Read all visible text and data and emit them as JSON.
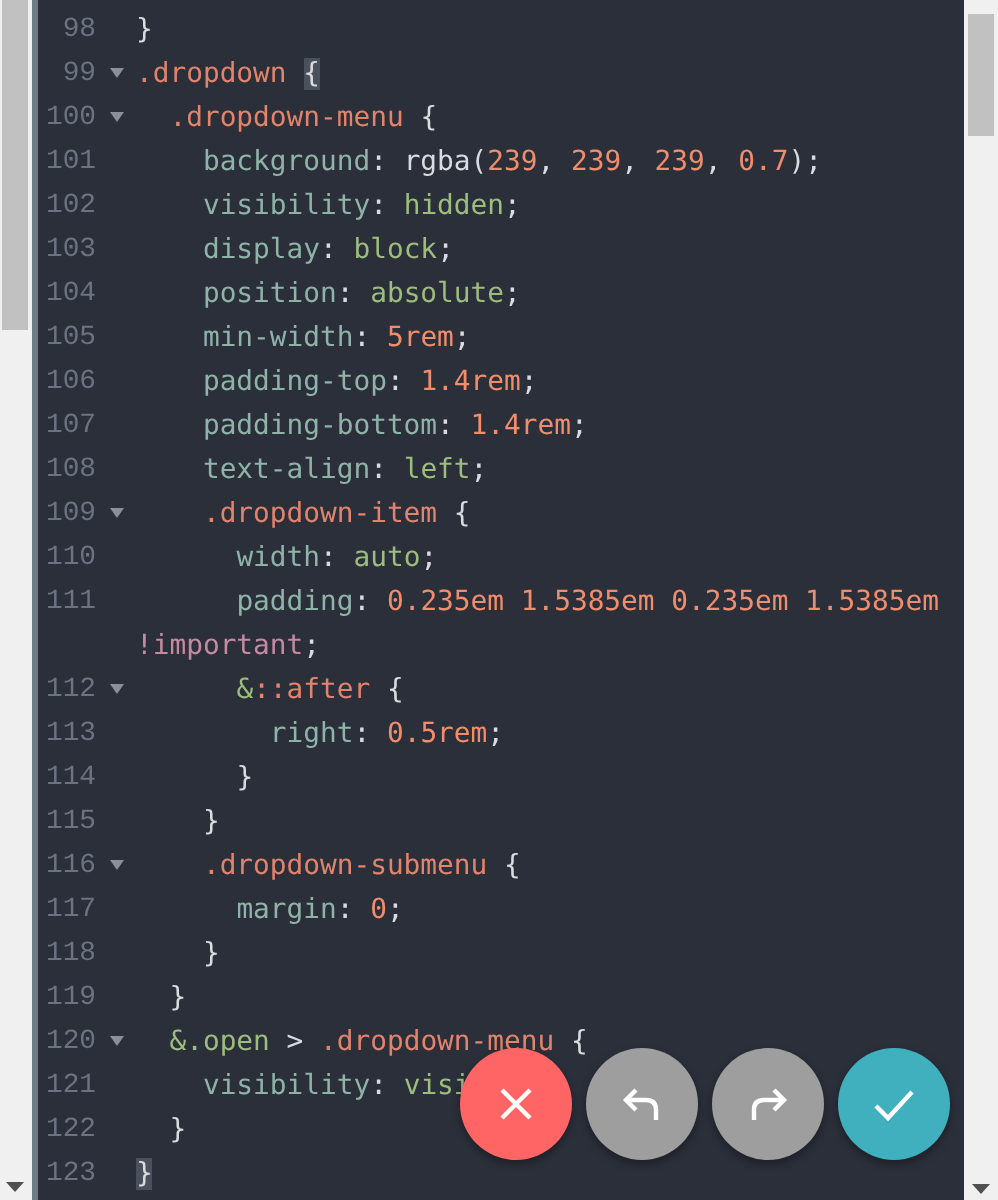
{
  "editor": {
    "lines": [
      {
        "number": "98",
        "foldable": false,
        "tokens": [
          {
            "kind": "bracket",
            "text": "}",
            "matched": false
          }
        ]
      },
      {
        "number": "99",
        "foldable": true,
        "tokens": [
          {
            "kind": "selector",
            "text": ".dropdown "
          },
          {
            "kind": "bracket",
            "text": "{",
            "matched": true
          }
        ]
      },
      {
        "number": "100",
        "foldable": true,
        "tokens": [
          {
            "kind": "selector",
            "text": "  .dropdown-menu "
          },
          {
            "kind": "bracket",
            "text": "{",
            "matched": false
          }
        ]
      },
      {
        "number": "101",
        "foldable": false,
        "tokens": [
          {
            "kind": "property",
            "text": "    background"
          },
          {
            "kind": "punct",
            "text": ": rgba("
          },
          {
            "kind": "number",
            "text": "239"
          },
          {
            "kind": "punct",
            "text": ", "
          },
          {
            "kind": "number",
            "text": "239"
          },
          {
            "kind": "punct",
            "text": ", "
          },
          {
            "kind": "number",
            "text": "239"
          },
          {
            "kind": "punct",
            "text": ", "
          },
          {
            "kind": "number",
            "text": "0.7"
          },
          {
            "kind": "punct",
            "text": ");"
          }
        ]
      },
      {
        "number": "102",
        "foldable": false,
        "tokens": [
          {
            "kind": "property",
            "text": "    visibility"
          },
          {
            "kind": "punct",
            "text": ": "
          },
          {
            "kind": "keyword",
            "text": "hidden"
          },
          {
            "kind": "punct",
            "text": ";"
          }
        ]
      },
      {
        "number": "103",
        "foldable": false,
        "tokens": [
          {
            "kind": "property",
            "text": "    display"
          },
          {
            "kind": "punct",
            "text": ": "
          },
          {
            "kind": "keyword",
            "text": "block"
          },
          {
            "kind": "punct",
            "text": ";"
          }
        ]
      },
      {
        "number": "104",
        "foldable": false,
        "tokens": [
          {
            "kind": "property",
            "text": "    position"
          },
          {
            "kind": "punct",
            "text": ": "
          },
          {
            "kind": "keyword",
            "text": "absolute"
          },
          {
            "kind": "punct",
            "text": ";"
          }
        ]
      },
      {
        "number": "105",
        "foldable": false,
        "tokens": [
          {
            "kind": "property",
            "text": "    min-width"
          },
          {
            "kind": "punct",
            "text": ": "
          },
          {
            "kind": "number",
            "text": "5rem"
          },
          {
            "kind": "punct",
            "text": ";"
          }
        ]
      },
      {
        "number": "106",
        "foldable": false,
        "tokens": [
          {
            "kind": "property",
            "text": "    padding-top"
          },
          {
            "kind": "punct",
            "text": ": "
          },
          {
            "kind": "number",
            "text": "1.4rem"
          },
          {
            "kind": "punct",
            "text": ";"
          }
        ]
      },
      {
        "number": "107",
        "foldable": false,
        "tokens": [
          {
            "kind": "property",
            "text": "    padding-bottom"
          },
          {
            "kind": "punct",
            "text": ": "
          },
          {
            "kind": "number",
            "text": "1.4rem"
          },
          {
            "kind": "punct",
            "text": ";"
          }
        ]
      },
      {
        "number": "108",
        "foldable": false,
        "tokens": [
          {
            "kind": "property",
            "text": "    text-align"
          },
          {
            "kind": "punct",
            "text": ": "
          },
          {
            "kind": "keyword",
            "text": "left"
          },
          {
            "kind": "punct",
            "text": ";"
          }
        ]
      },
      {
        "number": "109",
        "foldable": true,
        "tokens": [
          {
            "kind": "selector",
            "text": "    .dropdown-item "
          },
          {
            "kind": "bracket",
            "text": "{",
            "matched": false
          }
        ]
      },
      {
        "number": "110",
        "foldable": false,
        "tokens": [
          {
            "kind": "property",
            "text": "      width"
          },
          {
            "kind": "punct",
            "text": ": "
          },
          {
            "kind": "keyword",
            "text": "auto"
          },
          {
            "kind": "punct",
            "text": ";"
          }
        ]
      },
      {
        "number": "111",
        "foldable": false,
        "tokens": [
          {
            "kind": "property",
            "text": "      padding"
          },
          {
            "kind": "punct",
            "text": ": "
          },
          {
            "kind": "number",
            "text": "0.235em 1.5385em 0.235em 1.5385em"
          },
          {
            "kind": "important",
            "text": " !important"
          },
          {
            "kind": "punct",
            "text": ";"
          }
        ]
      },
      {
        "number": "112",
        "foldable": true,
        "tokens": [
          {
            "kind": "keyword",
            "text": "      &"
          },
          {
            "kind": "selector",
            "text": "::after "
          },
          {
            "kind": "bracket",
            "text": "{",
            "matched": false
          }
        ]
      },
      {
        "number": "113",
        "foldable": false,
        "tokens": [
          {
            "kind": "property",
            "text": "        right"
          },
          {
            "kind": "punct",
            "text": ": "
          },
          {
            "kind": "number",
            "text": "0.5rem"
          },
          {
            "kind": "punct",
            "text": ";"
          }
        ]
      },
      {
        "number": "114",
        "foldable": false,
        "tokens": [
          {
            "kind": "bracket",
            "text": "      }",
            "matched": false
          }
        ]
      },
      {
        "number": "115",
        "foldable": false,
        "tokens": [
          {
            "kind": "bracket",
            "text": "    }",
            "matched": false
          }
        ]
      },
      {
        "number": "116",
        "foldable": true,
        "tokens": [
          {
            "kind": "selector",
            "text": "    .dropdown-submenu "
          },
          {
            "kind": "bracket",
            "text": "{",
            "matched": false
          }
        ]
      },
      {
        "number": "117",
        "foldable": false,
        "tokens": [
          {
            "kind": "property",
            "text": "      margin"
          },
          {
            "kind": "punct",
            "text": ": "
          },
          {
            "kind": "number",
            "text": "0"
          },
          {
            "kind": "punct",
            "text": ";"
          }
        ]
      },
      {
        "number": "118",
        "foldable": false,
        "tokens": [
          {
            "kind": "bracket",
            "text": "    }",
            "matched": false
          }
        ]
      },
      {
        "number": "119",
        "foldable": false,
        "tokens": [
          {
            "kind": "bracket",
            "text": "  }",
            "matched": false
          }
        ]
      },
      {
        "number": "120",
        "foldable": true,
        "tokens": [
          {
            "kind": "keyword",
            "text": "  &.open"
          },
          {
            "kind": "punct",
            "text": " > "
          },
          {
            "kind": "selector",
            "text": ".dropdown-menu "
          },
          {
            "kind": "bracket",
            "text": "{",
            "matched": false
          }
        ]
      },
      {
        "number": "121",
        "foldable": false,
        "tokens": [
          {
            "kind": "property",
            "text": "    visibility"
          },
          {
            "kind": "punct",
            "text": ": "
          },
          {
            "kind": "keyword",
            "text": "visi"
          }
        ]
      },
      {
        "number": "122",
        "foldable": false,
        "tokens": [
          {
            "kind": "bracket",
            "text": "  }",
            "matched": false
          }
        ]
      },
      {
        "number": "123",
        "foldable": false,
        "tokens": [
          {
            "kind": "bracket",
            "text": "}",
            "matched": true
          }
        ]
      }
    ]
  },
  "actions": [
    {
      "kind": "cancel"
    },
    {
      "kind": "undo"
    },
    {
      "kind": "redo"
    },
    {
      "kind": "confirm"
    }
  ]
}
